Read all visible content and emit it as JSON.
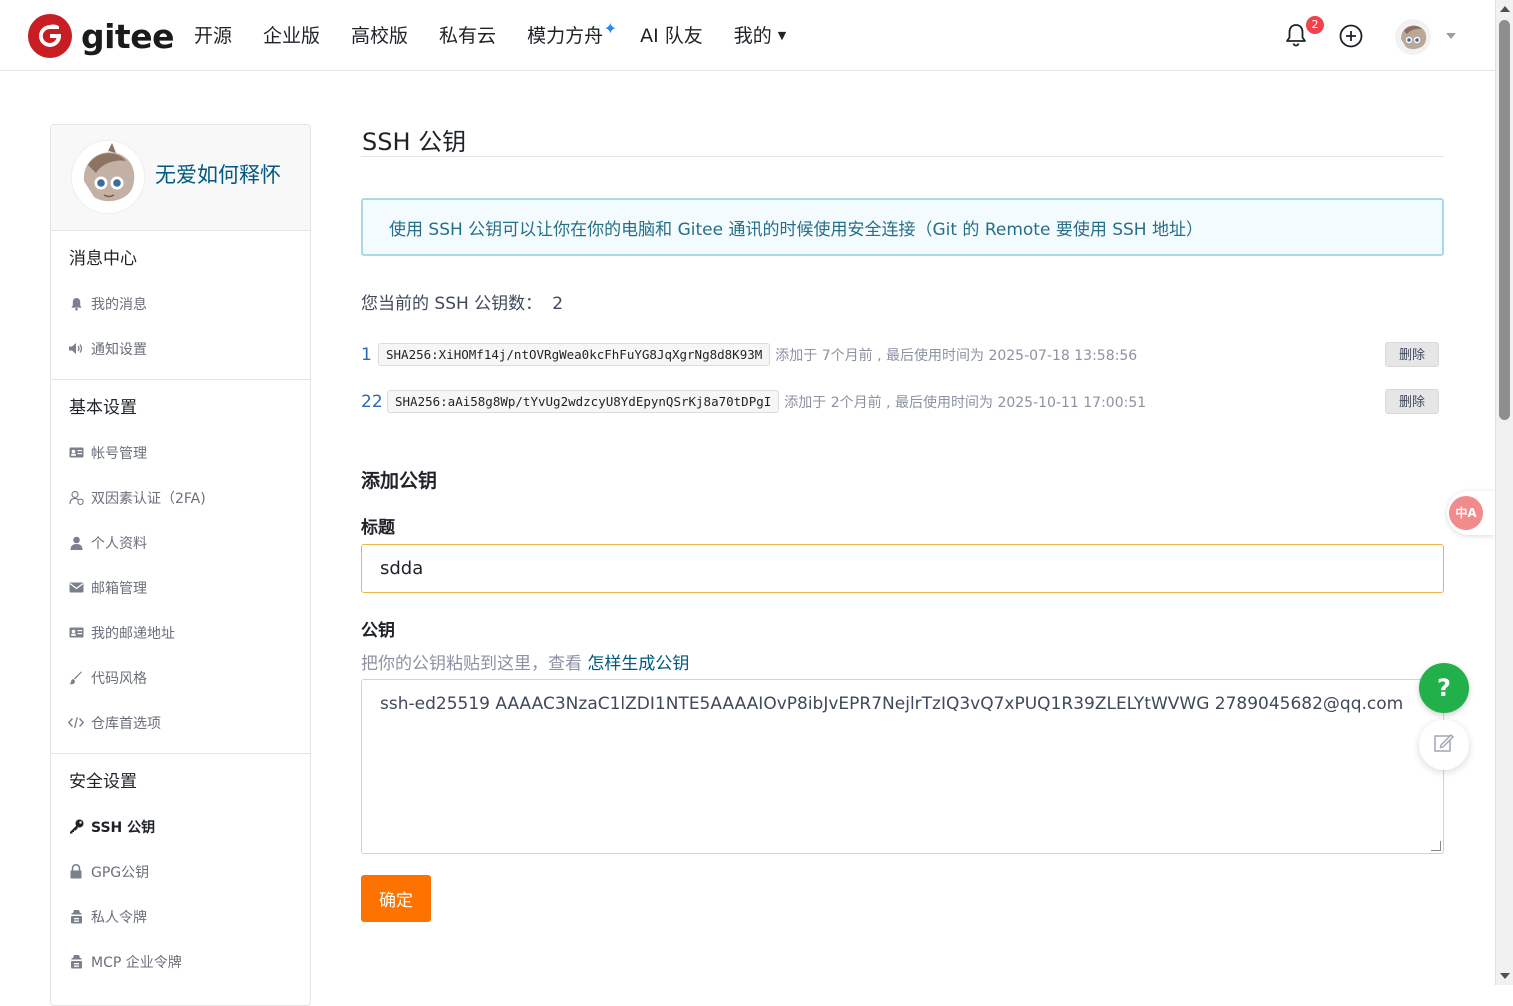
{
  "header": {
    "logo_text": "gitee",
    "nav": [
      {
        "label": "开源"
      },
      {
        "label": "企业版"
      },
      {
        "label": "高校版"
      },
      {
        "label": "私有云"
      },
      {
        "label": "模力方舟"
      },
      {
        "label": "AI 队友"
      },
      {
        "label": "我的"
      }
    ],
    "notification_count": "2",
    "icons": {
      "notifications": "bell-icon",
      "create": "plus-circle-icon",
      "avatar_menu": "chevron-down-icon"
    },
    "brand_color": "#c71d23"
  },
  "sidebar": {
    "username": "无爱如何释怀",
    "groups": [
      {
        "title": "消息中心",
        "items": [
          {
            "label": "我的消息",
            "icon": "bell-icon"
          },
          {
            "label": "通知设置",
            "icon": "speaker-icon"
          }
        ]
      },
      {
        "title": "基本设置",
        "items": [
          {
            "label": "帐号管理",
            "icon": "id-card-icon"
          },
          {
            "label": "双因素认证（2FA)",
            "icon": "user-shield-icon"
          },
          {
            "label": "个人资料",
            "icon": "user-icon"
          },
          {
            "label": "邮箱管理",
            "icon": "envelope-icon"
          },
          {
            "label": "我的邮递地址",
            "icon": "address-card-icon"
          },
          {
            "label": "代码风格",
            "icon": "brush-icon"
          },
          {
            "label": "仓库首选项",
            "icon": "code-icon"
          }
        ]
      },
      {
        "title": "安全设置",
        "items": [
          {
            "label": "SSH 公钥",
            "icon": "key-icon",
            "active": true
          },
          {
            "label": "GPG公钥",
            "icon": "lock-icon"
          },
          {
            "label": "私人令牌",
            "icon": "token-icon"
          },
          {
            "label": "MCP 企业令牌",
            "icon": "token-icon"
          }
        ]
      }
    ]
  },
  "main": {
    "title": "SSH 公钥",
    "info": "使用 SSH 公钥可以让你在你的电脑和 Gitee 通讯的时候使用安全连接（Git 的 Remote 要使用 SSH 地址）",
    "count_label": "您当前的 SSH 公钥数：",
    "count_value": "2",
    "keys": [
      {
        "index": "1",
        "fingerprint": "SHA256:XiHOMf14j/ntOVRgWea0kcFhFuYG8JqXgrNg8d8K93M",
        "meta": "添加于 7个月前 , 最后使用时间为 2025-07-18 13:58:56",
        "delete_label": "删除"
      },
      {
        "index": "22",
        "fingerprint": "SHA256:aAi58g8Wp/tYvUg2wdzcyU8YdEpynQSrKj8a70tDPgI",
        "meta": "添加于 2个月前 , 最后使用时间为 2025-10-11 17:00:51",
        "delete_label": "删除"
      }
    ],
    "add_section_title": "添加公钥",
    "title_label": "标题",
    "title_value": "sdda",
    "key_label": "公钥",
    "key_hint": "把你的公钥粘贴到这里，查看 ",
    "key_hint_link": "怎样生成公钥",
    "key_value": "ssh-ed25519 AAAAC3NzaC1lZDI1NTE5AAAAIOvP8ibJvEPR7NejlrTzIQ3vQ7xPUQ1R39ZLELYtWVWG 2789045682@qq.com",
    "submit_label": "确定",
    "submit_color": "#fe7300"
  },
  "floating": {
    "translate_label": "中A",
    "help_label": "?",
    "help_color": "#22b04a",
    "feedback_icon": "edit-icon"
  }
}
